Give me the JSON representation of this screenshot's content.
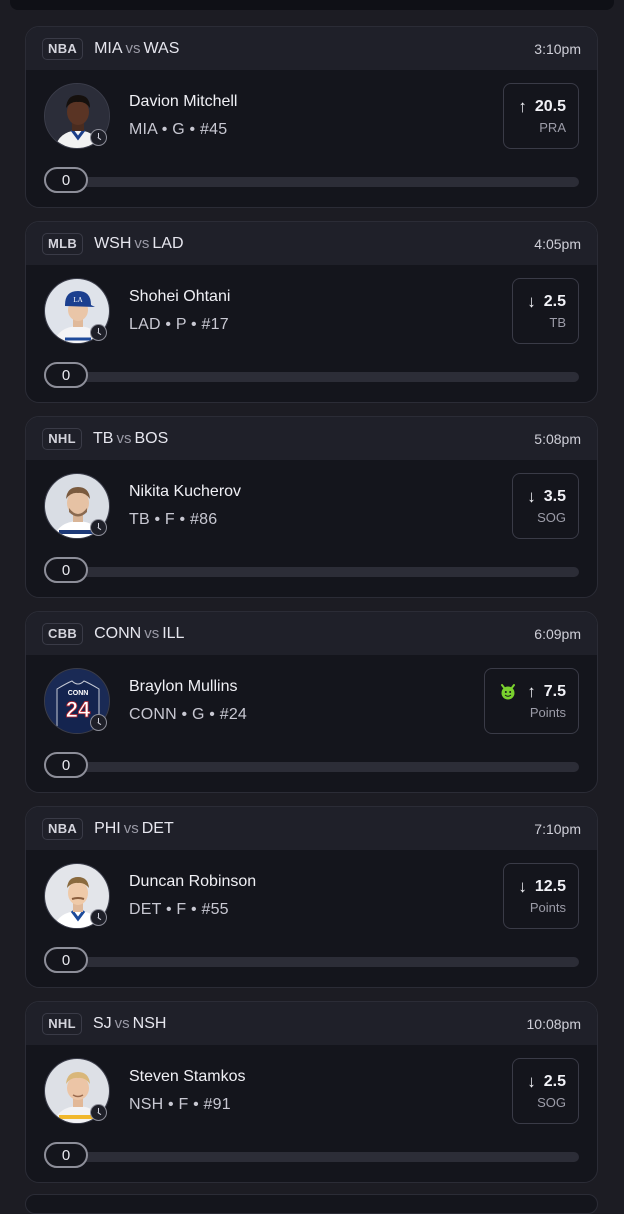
{
  "cards": [
    {
      "league": "NBA",
      "team1": "MIA",
      "vs": "vs",
      "team2": "WAS",
      "time": "3:10pm",
      "player": "Davion Mitchell",
      "info": "MIA • G • #45",
      "direction": "up",
      "arrow": "↑",
      "line": "20.5",
      "stat": "PRA",
      "count": "0",
      "avatar": "dark-skin-player",
      "progress": 0
    },
    {
      "league": "MLB",
      "team1": "WSH",
      "vs": "vs",
      "team2": "LAD",
      "time": "4:05pm",
      "player": "Shohei Ohtani",
      "info": "LAD • P • #17",
      "direction": "down",
      "arrow": "↓",
      "line": "2.5",
      "stat": "TB",
      "count": "0",
      "avatar": "cap-player",
      "progress": 0
    },
    {
      "league": "NHL",
      "team1": "TB",
      "vs": "vs",
      "team2": "BOS",
      "time": "5:08pm",
      "player": "Nikita Kucherov",
      "info": "TB • F • #86",
      "direction": "down",
      "arrow": "↓",
      "line": "3.5",
      "stat": "SOG",
      "count": "0",
      "avatar": "bearded-player",
      "progress": 0
    },
    {
      "league": "CBB",
      "team1": "CONN",
      "vs": "vs",
      "team2": "ILL",
      "time": "6:09pm",
      "player": "Braylon Mullins",
      "info": "CONN • G • #24",
      "direction": "up",
      "arrow": "↑",
      "line": "7.5",
      "stat": "Points",
      "count": "0",
      "avatar": "jersey-24",
      "jersey_text": "CONN",
      "jersey_number": "24",
      "badge": "devil-icon",
      "badge_color": "#7ad12e",
      "progress": 0
    },
    {
      "league": "NBA",
      "team1": "PHI",
      "vs": "vs",
      "team2": "DET",
      "time": "7:10pm",
      "player": "Duncan Robinson",
      "info": "DET • F • #55",
      "direction": "down",
      "arrow": "↓",
      "line": "12.5",
      "stat": "Points",
      "count": "0",
      "avatar": "mustache-player",
      "progress": 0
    },
    {
      "league": "NHL",
      "team1": "SJ",
      "vs": "vs",
      "team2": "NSH",
      "time": "10:08pm",
      "player": "Steven Stamkos",
      "info": "NSH • F • #91",
      "direction": "down",
      "arrow": "↓",
      "line": "2.5",
      "stat": "SOG",
      "count": "0",
      "avatar": "blond-player",
      "progress": 0
    }
  ],
  "colors": {
    "background": "#1c1c23",
    "card": "#14151c",
    "card_header": "#1f2029",
    "border": "#2b2c36",
    "muted_text": "#9c9ca8"
  }
}
